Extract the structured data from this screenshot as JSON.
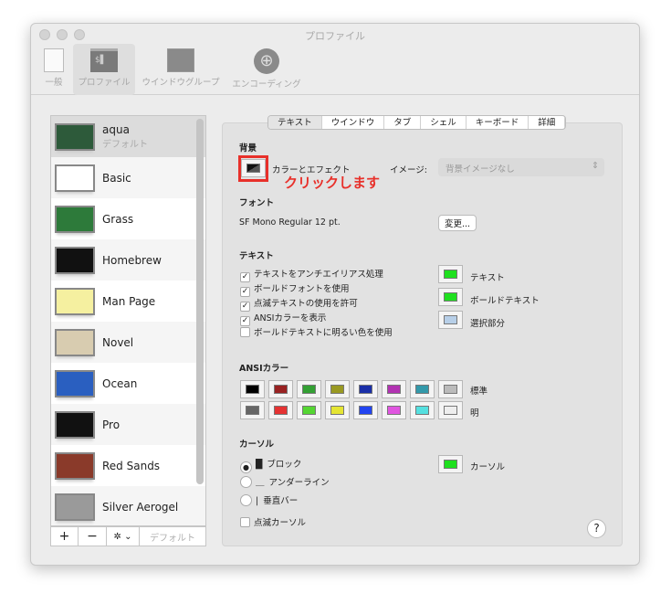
{
  "window": {
    "title": "プロファイル"
  },
  "toolbar": [
    {
      "label": "一般",
      "icon": "general-switch-icon"
    },
    {
      "label": "プロファイル",
      "icon": "terminal-icon"
    },
    {
      "label": "ウインドウグループ",
      "icon": "window-group-icon"
    },
    {
      "label": "エンコーディング",
      "icon": "globe-icon"
    }
  ],
  "profiles": [
    {
      "name": "aqua",
      "sub": "デフォルト",
      "color": "#2d5a3a",
      "selected": true
    },
    {
      "name": "Basic",
      "color": "#ffffff"
    },
    {
      "name": "Grass",
      "color": "#2d7a3a"
    },
    {
      "name": "Homebrew",
      "color": "#111111"
    },
    {
      "name": "Man Page",
      "color": "#f5f0a0"
    },
    {
      "name": "Novel",
      "color": "#d8ccb0"
    },
    {
      "name": "Ocean",
      "color": "#2a5fc0"
    },
    {
      "name": "Pro",
      "color": "#111111"
    },
    {
      "name": "Red Sands",
      "color": "#8a3a2a"
    },
    {
      "name": "Silver Aerogel",
      "color": "#9a9a9a"
    }
  ],
  "list_buttons": {
    "add": "+",
    "remove": "−",
    "gear": "✲ ⌄",
    "default": "デフォルト"
  },
  "tabs": [
    "テキスト",
    "ウインドウ",
    "タブ",
    "シェル",
    "キーボード",
    "詳細"
  ],
  "background": {
    "heading": "背景",
    "color_effect": "カラーとエフェクト",
    "image_label": "イメージ:",
    "image_value": "背景イメージなし",
    "annotation": "クリックします",
    "annotation_color": "#e8302a"
  },
  "font": {
    "heading": "フォント",
    "value": "SF Mono Regular 12 pt.",
    "change": "変更..."
  },
  "text": {
    "heading": "テキスト",
    "options": [
      {
        "label": "テキストをアンチエイリアス処理",
        "checked": true
      },
      {
        "label": "ボールドフォントを使用",
        "checked": true
      },
      {
        "label": "点滅テキストの使用を許可",
        "checked": true
      },
      {
        "label": "ANSIカラーを表示",
        "checked": true
      },
      {
        "label": "ボールドテキストに明るい色を使用",
        "checked": false
      }
    ],
    "colors": [
      {
        "label": "テキスト",
        "color": "#1fe01f"
      },
      {
        "label": "ボールドテキスト",
        "color": "#1fe01f"
      },
      {
        "label": "選択部分",
        "color": "#b7cfe8"
      }
    ]
  },
  "ansi": {
    "heading": "ANSIカラー",
    "normal_label": "標準",
    "bright_label": "明",
    "normal": [
      "#000000",
      "#992222",
      "#33a033",
      "#999922",
      "#1a2fa8",
      "#b233b2",
      "#3399aa",
      "#bbbbbb"
    ],
    "bright": [
      "#666666",
      "#e53333",
      "#55d633",
      "#e5e533",
      "#2244f0",
      "#e055e0",
      "#55e0e0",
      "#eeeeee"
    ]
  },
  "cursor": {
    "heading": "カーソル",
    "options": [
      {
        "glyph": "█",
        "label": "ブロック",
        "selected": true
      },
      {
        "glyph": "＿",
        "label": "アンダーライン",
        "selected": false
      },
      {
        "glyph": "|",
        "label": "垂直バー",
        "selected": false
      }
    ],
    "blink": "点滅カーソル",
    "color_label": "カーソル",
    "color": "#1fe01f"
  },
  "help": "?"
}
